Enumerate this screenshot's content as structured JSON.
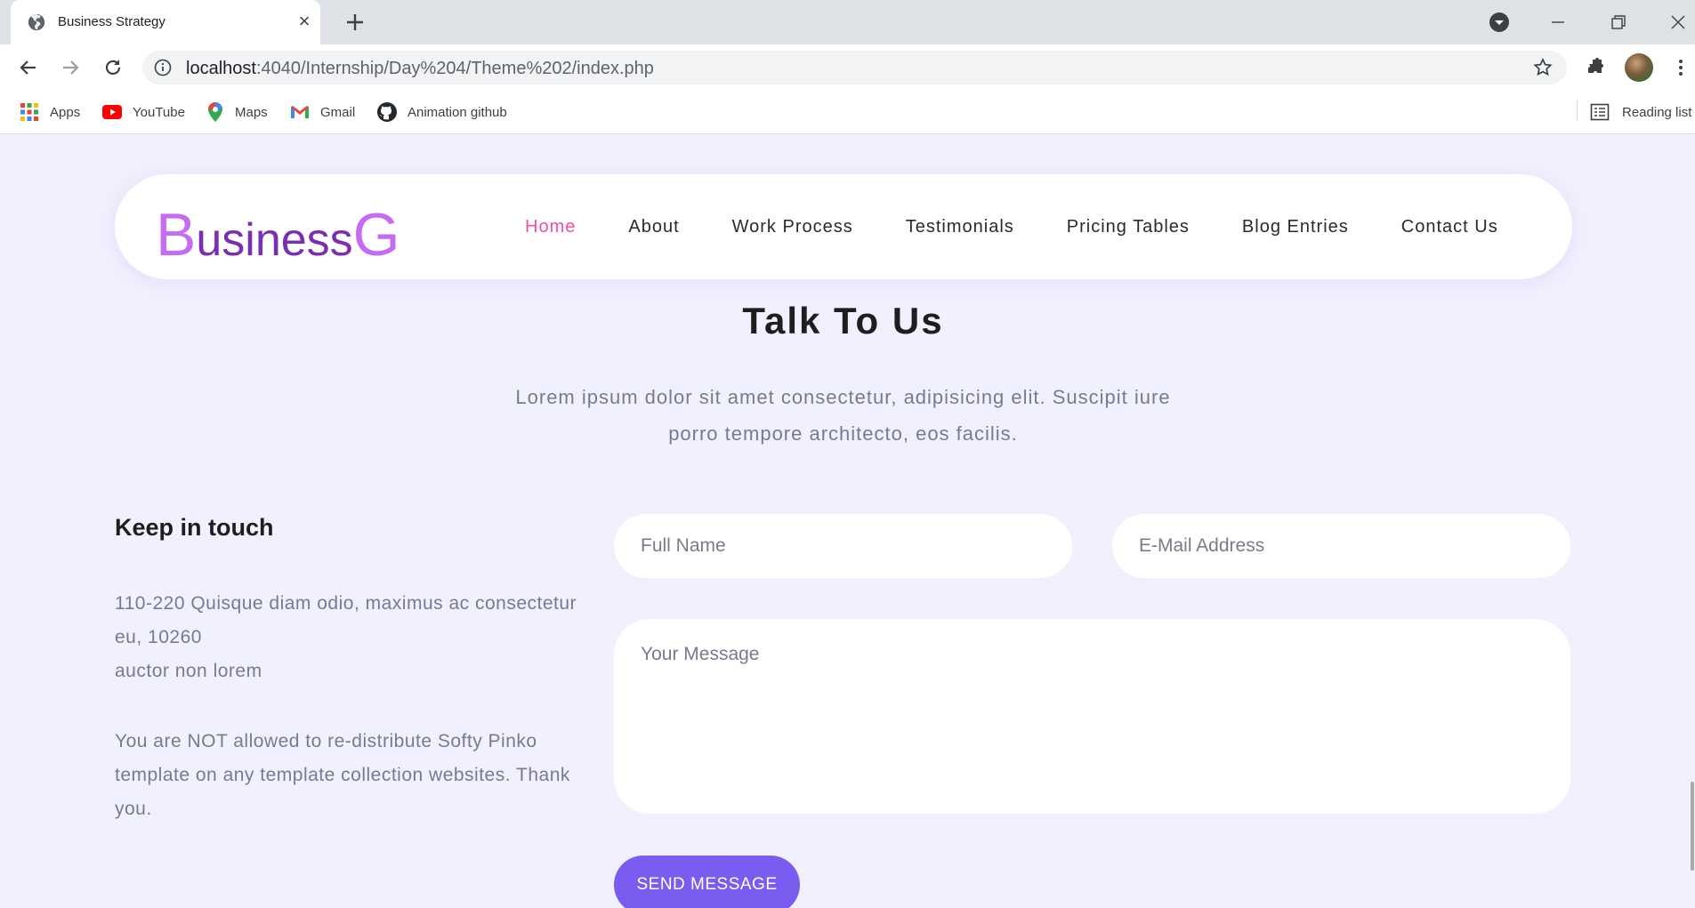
{
  "browser": {
    "tab_title": "Business Strategy",
    "url_host": "localhost",
    "url_path": ":4040/Internship/Day%204/Theme%202/index.php",
    "bookmarks": [
      {
        "label": "Apps",
        "icon": "apps-grid-icon"
      },
      {
        "label": "YouTube",
        "icon": "youtube-icon"
      },
      {
        "label": "Maps",
        "icon": "maps-pin-icon"
      },
      {
        "label": "Gmail",
        "icon": "gmail-icon"
      },
      {
        "label": "Animation github",
        "icon": "github-icon"
      }
    ],
    "reading_list": "Reading list"
  },
  "header": {
    "logo_cap": "B",
    "logo_rest": "usiness",
    "logo_tail": "G",
    "nav": [
      "Home",
      "About",
      "Work Process",
      "Testimonials",
      "Pricing Tables",
      "Blog Entries",
      "Contact Us"
    ],
    "active_nav": "Home"
  },
  "contact": {
    "title": "Talk To Us",
    "description": "Lorem ipsum dolor sit amet consectetur, adipisicing elit. Suscipit iure porro tempore architecto, eos facilis.",
    "keep_title": "Keep in touch",
    "address_line1": "110-220 Quisque diam odio, maximus ac consectetur eu, 10260",
    "address_line2": "auctor non lorem",
    "notice": "You are NOT allowed to re-distribute Softy Pinko template on any template collection websites. Thank you.",
    "name_placeholder": "Full Name",
    "email_placeholder": "E-Mail Address",
    "message_placeholder": "Your Message",
    "send_label": "SEND MESSAGE"
  },
  "colors": {
    "accent": "#7a5cf0",
    "nav_active": "#f34f9f",
    "logo_light": "#c66bf2",
    "logo_dark": "#7a2fb3",
    "page_bg": "#f1f0fe"
  }
}
